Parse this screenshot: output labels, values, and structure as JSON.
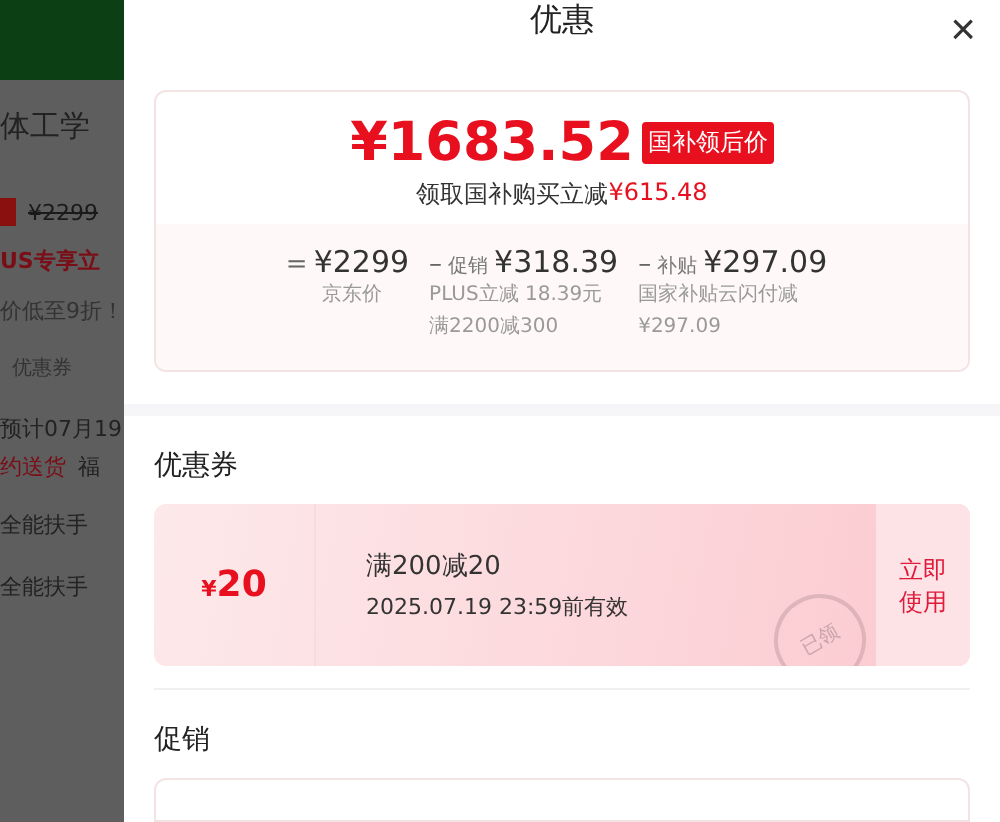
{
  "background_page": {
    "title": "体工学",
    "price_badge_visible": true,
    "old_price": "¥2299",
    "plus_text": "US专享立",
    "discount_text": "价低至9折！",
    "coupon_label": "优惠券",
    "delivery_date": "预计07月19",
    "delivery_note": "约送货",
    "delivery_extra": "福",
    "features": [
      "全能扶手",
      "全能扶手"
    ]
  },
  "sheet": {
    "title": "优惠",
    "close": "×"
  },
  "price_card": {
    "price": "¥1683.52",
    "badge": "国补领后价",
    "saving_label": "领取国补购买立减",
    "saving_amount": "¥615.48",
    "breakdown": [
      {
        "operator": "=",
        "amount": "¥2299",
        "notes": [
          "京东价"
        ]
      },
      {
        "operator": "–",
        "tag": "促销",
        "amount": "¥318.39",
        "notes": [
          "PLUS立减 18.39元",
          "满2200减300"
        ]
      },
      {
        "operator": "–",
        "tag": "补贴",
        "amount": "¥297.09",
        "notes": [
          "国家补贴云闪付减¥297.09"
        ]
      }
    ]
  },
  "coupons": {
    "heading": "优惠券",
    "items": [
      {
        "currency": "¥",
        "value": "20",
        "title": "满200减20",
        "validity": "2025.07.19 23:59前有效",
        "claimed": true,
        "stamp": "已领",
        "action": "立即使用"
      }
    ]
  },
  "promotions": {
    "heading": "促销"
  }
}
